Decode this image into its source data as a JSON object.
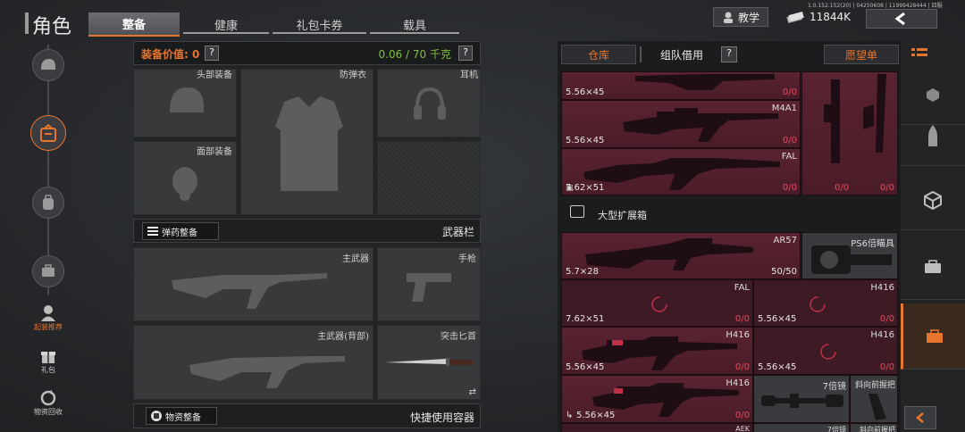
{
  "header": {
    "title": "角色",
    "tabs": [
      "整备",
      "健康",
      "礼包卡券",
      "载具"
    ],
    "active_tab": "整备",
    "tutorial": "教学",
    "currency": "11844K",
    "version_text": "1.0.152.152(20) | 04250608 | 11999428444 | 四服"
  },
  "left": {
    "value_label": "装备价值: 0",
    "weight": "0.06 / 70 千克",
    "help": "?",
    "slots": {
      "mask_gear": "头部装备",
      "armor": "防弹衣",
      "headset": "耳机",
      "face_gear": "面部装备"
    },
    "ammo_btn": "弹药整备",
    "weapon_bar": "武器栏",
    "primary": "主武器",
    "pistol": "手枪",
    "primary_back": "主武器(背部)",
    "dagger": "突击匕首",
    "supply_btn": "物资整备",
    "quick_use": "快捷使用容器"
  },
  "sidebar": {
    "items": [
      "起装推荐",
      "礼包",
      "物资回收"
    ]
  },
  "right": {
    "tabs": [
      "仓库",
      "组队借用"
    ],
    "wishlist": "愿望单",
    "help": "?",
    "container_label": "大型扩展箱",
    "top_grid": {
      "rows": [
        {
          "ammo": "5.56×45",
          "name": "",
          "count": "0/0"
        },
        {
          "ammo": "5.56×45",
          "name": "M4A1",
          "count": "0/0"
        },
        {
          "ammo": "7.62×51",
          "name": "FAL",
          "count": "0/0"
        }
      ],
      "side_counts": [
        "0/0",
        "0/0",
        "0/0",
        "0/0"
      ]
    },
    "grid": {
      "ar57": {
        "name": "AR57",
        "ammo": "5.7×28",
        "count": "50/50"
      },
      "scope": {
        "name": "PS6倍瞄具"
      },
      "fal": {
        "name": "FAL",
        "ammo": "7.62×51",
        "count": "0/0"
      },
      "h416_a": {
        "name": "H416",
        "ammo": "5.56×45",
        "count": "0/0"
      },
      "h416_b": {
        "name": "H416",
        "ammo": "5.56×45",
        "count": "0/0"
      },
      "h416_c": {
        "name": "H416",
        "ammo": "5.56×45",
        "count": "0/0"
      },
      "h416_d": {
        "name": "H416",
        "ammo": "5.56×45",
        "count": "0/0"
      },
      "h416_e": {
        "name": "H416",
        "ammo": "5.56×45",
        "count": "0/0"
      },
      "scope7": {
        "name": "7倍镜"
      },
      "grip": {
        "name": "斜向前握把"
      },
      "bottom": [
        "AEK",
        "7倍镜",
        "斜向前握把"
      ]
    }
  },
  "colors": {
    "accent": "#e8752e",
    "red_count": "#e84a5f",
    "green_weight": "#7fbf3f"
  }
}
